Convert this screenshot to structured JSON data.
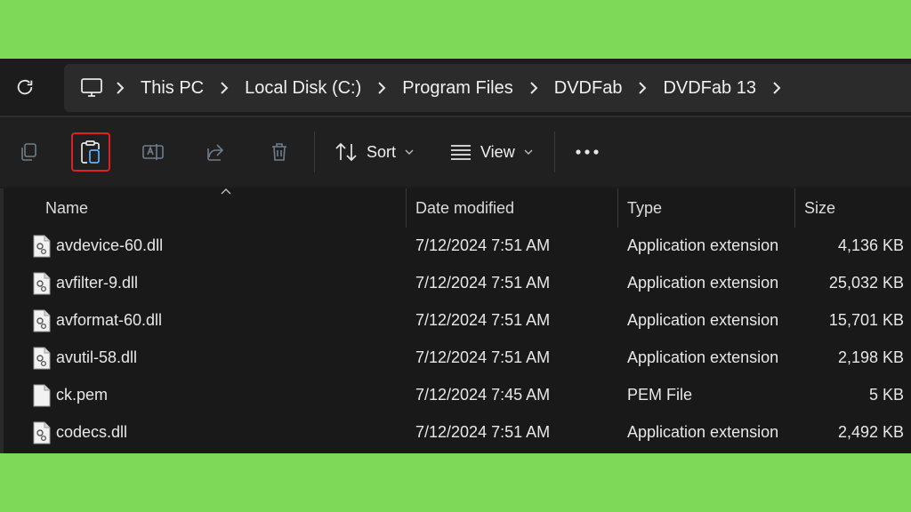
{
  "breadcrumb": {
    "items": [
      "This PC",
      "Local Disk (C:)",
      "Program Files",
      "DVDFab",
      "DVDFab 13"
    ]
  },
  "commandbar": {
    "sort_label": "Sort",
    "view_label": "View",
    "highlight_color": "#e02020"
  },
  "columns": {
    "name": "Name",
    "date": "Date modified",
    "type": "Type",
    "size": "Size"
  },
  "files": [
    {
      "name": "avdevice-60.dll",
      "date": "7/12/2024 7:51 AM",
      "type": "Application extension",
      "size": "4,136 KB",
      "icon": "dll-file-icon"
    },
    {
      "name": "avfilter-9.dll",
      "date": "7/12/2024 7:51 AM",
      "type": "Application extension",
      "size": "25,032 KB",
      "icon": "dll-file-icon"
    },
    {
      "name": "avformat-60.dll",
      "date": "7/12/2024 7:51 AM",
      "type": "Application extension",
      "size": "15,701 KB",
      "icon": "dll-file-icon"
    },
    {
      "name": "avutil-58.dll",
      "date": "7/12/2024 7:51 AM",
      "type": "Application extension",
      "size": "2,198 KB",
      "icon": "dll-file-icon"
    },
    {
      "name": "ck.pem",
      "date": "7/12/2024 7:45 AM",
      "type": "PEM File",
      "size": "5 KB",
      "icon": "blank-file-icon"
    },
    {
      "name": "codecs.dll",
      "date": "7/12/2024 7:51 AM",
      "type": "Application extension",
      "size": "2,492 KB",
      "icon": "dll-file-icon"
    }
  ],
  "colors": {
    "background": "#7ed957",
    "window": "#1c1c1c"
  }
}
